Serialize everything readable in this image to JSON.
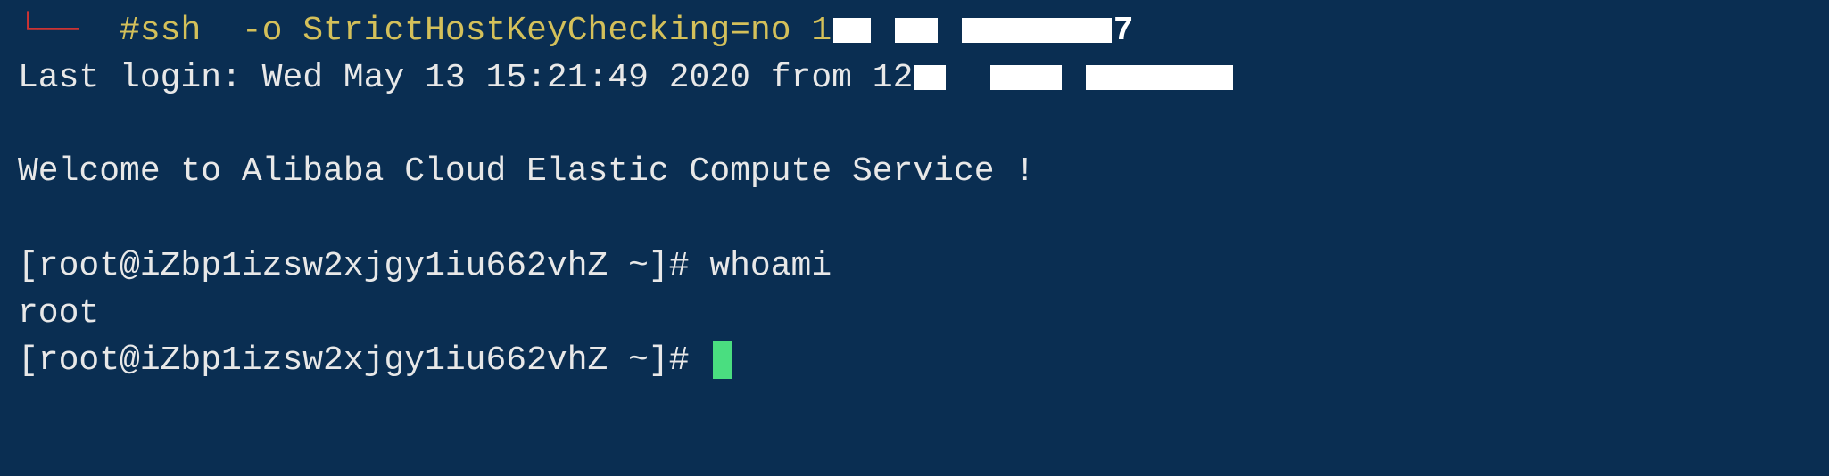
{
  "line1": {
    "arrow": "└──",
    "hash": "#",
    "command": "ssh  -o StrictHostKeyChecking=no 1",
    "redact_char": "7"
  },
  "line2": {
    "prefix": "Last login: Wed May 13 15:21:49 2020 from 1",
    "mid_char": "2"
  },
  "line3": {
    "text": "Welcome to Alibaba Cloud Elastic Compute Service !"
  },
  "line4": {
    "prompt": "[root@iZbp1izsw2xjgy1iu662vhZ ~]# ",
    "command": "whoami"
  },
  "line5": {
    "output": "root"
  },
  "line6": {
    "prompt": "[root@iZbp1izsw2xjgy1iu662vhZ ~]# "
  }
}
